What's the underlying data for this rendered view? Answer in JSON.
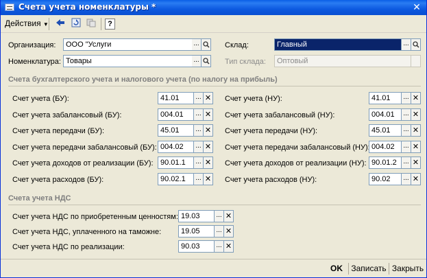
{
  "window": {
    "title": "Счета учета номенклатуры *",
    "close": "✕"
  },
  "toolbar": {
    "actions_label": "Действия",
    "help_label": "?"
  },
  "top": {
    "org_label": "Организация:",
    "org_value": "ООО \"Услуги",
    "nom_label": "Номенклатура:",
    "nom_value": "Товары",
    "sklad_label": "Склад:",
    "sklad_value": "Главный",
    "tip_label": "Тип склада:",
    "tip_value": "Оптовый"
  },
  "section1_title": "Счета бухгалтерского учета и налогового учета (по налогу на прибыль)",
  "bu_rows": [
    {
      "label": "Счет учета (БУ):",
      "value": "41.01"
    },
    {
      "label": "Счет учета забалансовый (БУ):",
      "value": "004.01"
    },
    {
      "label": "Счет учета передачи (БУ):",
      "value": "45.01"
    },
    {
      "label": "Счет учета передачи забалансовый (БУ):",
      "value": "004.02"
    },
    {
      "label": "Счет учета доходов от реализации (БУ):",
      "value": "90.01.1"
    },
    {
      "label": "Счет учета расходов (БУ):",
      "value": "90.02.1"
    }
  ],
  "nu_rows": [
    {
      "label": "Счет учета (НУ):",
      "value": "41.01"
    },
    {
      "label": "Счет учета забалансовый (НУ):",
      "value": "004.01"
    },
    {
      "label": "Счет учета передачи (НУ):",
      "value": "45.01"
    },
    {
      "label": "Счет учета передачи забалансовый (НУ):",
      "value": "004.02"
    },
    {
      "label": "Счет учета доходов от реализации (НУ):",
      "value": "90.01.2"
    },
    {
      "label": "Счет учета расходов (НУ):",
      "value": "90.02"
    }
  ],
  "section2_title": "Счета учета НДС",
  "nds_rows": [
    {
      "label": "Счет учета НДС по приобретенным ценностям:",
      "value": "19.03"
    },
    {
      "label": "Счет учета НДС, уплаченного на таможне:",
      "value": "19.05"
    },
    {
      "label": "Счет учета НДС по реализации:",
      "value": "90.03"
    }
  ],
  "buttons": {
    "ok": "OK",
    "save": "Записать",
    "close": "Закрыть"
  },
  "glyphs": {
    "ellipsis": "...",
    "clear": "✕",
    "search": "search-icon"
  },
  "colors": {
    "title_bar": "#0a5fe6",
    "selection": "#0a246a",
    "window_bg": "#ece9d8"
  }
}
